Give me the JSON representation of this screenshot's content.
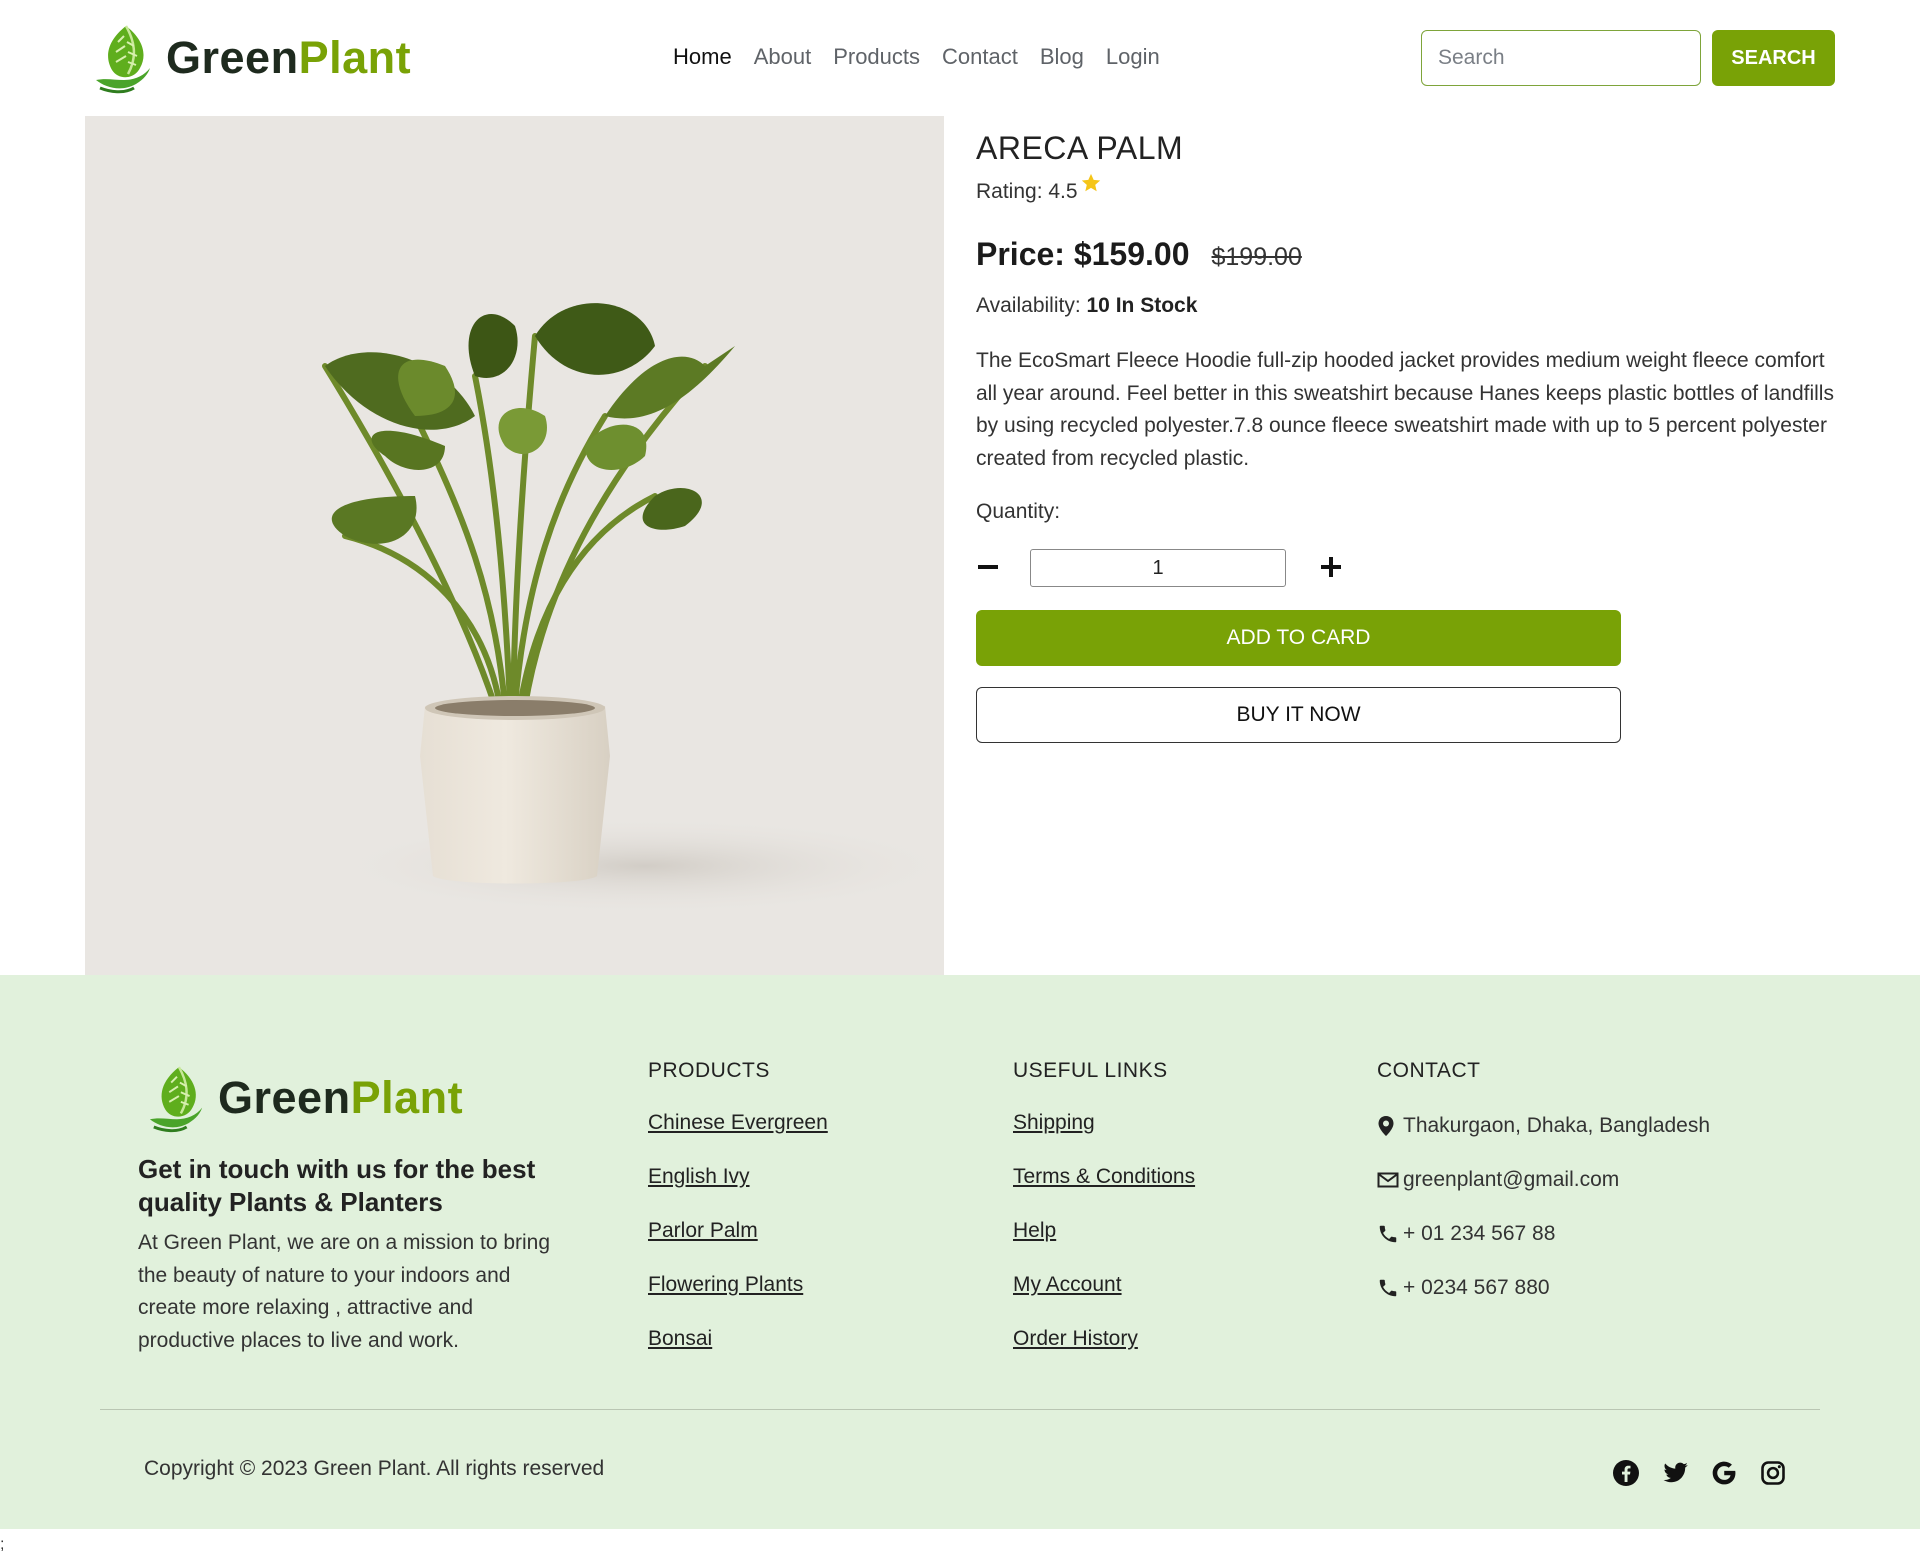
{
  "brand": {
    "name_part1": "Green",
    "name_part2": "Plant",
    "accent_color": "#79a206",
    "dark_color": "#1e2a1e"
  },
  "nav": {
    "items": [
      {
        "label": "Home",
        "active": true
      },
      {
        "label": "About"
      },
      {
        "label": "Products"
      },
      {
        "label": "Contact"
      },
      {
        "label": "Blog"
      },
      {
        "label": "Login"
      }
    ]
  },
  "search": {
    "placeholder": "Search",
    "button_label": "SEARCH"
  },
  "product": {
    "title": "ARECA PALM",
    "rating_label": "Rating: 4.5",
    "price_label": "Price: $159.00",
    "old_price": "$199.00",
    "availability_label": "Availability: ",
    "availability_value": "10 In Stock",
    "description": "The EcoSmart Fleece Hoodie full-zip hooded jacket provides medium weight fleece comfort all year around. Feel better in this sweatshirt because Hanes keeps plastic bottles of landfills by using recycled polyester.7.8 ounce fleece sweatshirt made with up to 5 percent polyester created from recycled plastic.",
    "quantity_label": "Quantity:",
    "quantity_value": "1",
    "add_to_cart_label": "ADD TO CARD",
    "buy_now_label": "BUY IT NOW",
    "star_color": "#f5c518"
  },
  "footer": {
    "tagline": "Get in touch with us for the best quality Plants & Planters",
    "about": "At Green Plant, we are on a mission to bring the beauty of nature to your indoors and create more relaxing , attractive and productive places to live and work.",
    "products": {
      "heading": "PRODUCTS",
      "items": [
        "Chinese Evergreen",
        "English Ivy",
        "Parlor Palm",
        "Flowering Plants",
        "Bonsai"
      ]
    },
    "useful_links": {
      "heading": "USEFUL LINKS",
      "items": [
        "Shipping",
        "Terms & Conditions",
        "Help",
        "My Account",
        "Order History"
      ]
    },
    "contact": {
      "heading": "CONTACT",
      "address": "Thakurgaon, Dhaka, Bangladesh",
      "email": "greenplant@gmail.com",
      "phone1": "+ 01 234 567 88",
      "phone2": "+ 0234 567 880"
    },
    "copyright": "Copyright © 2023 Green Plant. All rights reserved",
    "socials": [
      "facebook-icon",
      "twitter-icon",
      "google-icon",
      "instagram-icon"
    ],
    "background_color": "#e1f1dc"
  },
  "stray_text": ";"
}
